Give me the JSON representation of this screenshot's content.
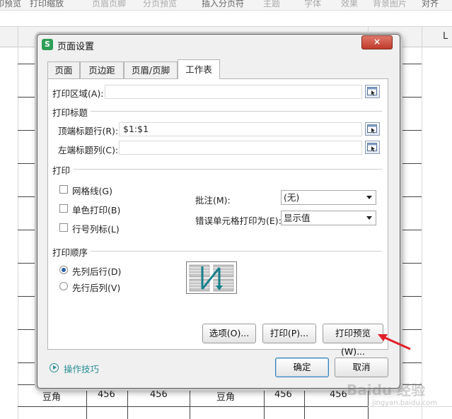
{
  "toolbar": {
    "items": [
      "印预览",
      "打印缩放",
      "页眉页脚",
      "分页预览",
      "插入分页符",
      "主题",
      "字体",
      "效果",
      "背景图片",
      "对齐"
    ]
  },
  "sheet": {
    "column_label_L": "L",
    "data_row": [
      "豆角",
      "456",
      "456",
      "豆角",
      "456",
      "456"
    ]
  },
  "dialog": {
    "title": "页面设置",
    "app_icon_letter": "S",
    "close_label": "×",
    "tabs": [
      "页面",
      "页边距",
      "页眉/页脚",
      "工作表"
    ],
    "active_tab": "工作表",
    "print_area_label": "打印区域(A):",
    "print_area_value": "",
    "print_titles_section": "打印标题",
    "top_rows_label": "顶端标题行(R):",
    "top_rows_value": "$1:$1",
    "left_cols_label": "左端标题列(C):",
    "left_cols_value": "",
    "print_section": "打印",
    "gridlines_label": "网格线(G)",
    "mono_label": "单色打印(B)",
    "rowcol_label": "行号列标(L)",
    "comments_label": "批注(M):",
    "comments_value": "(无)",
    "errors_label": "错误单元格打印为(E):",
    "errors_value": "显示值",
    "order_section": "打印顺序",
    "order_down_then_over": "先列后行(D)",
    "order_over_then_down": "先行后列(V)",
    "options_button": "选项(O)...",
    "print_button": "打印(P)...",
    "preview_button": "打印预览(W)...",
    "tips_label": "操作技巧",
    "ok_button": "确定",
    "cancel_button": "取消"
  },
  "watermark": {
    "text": "Baidu 经验",
    "sub": "jingyan.baidu.com"
  },
  "colors": {
    "accent_teal": "#2a8f99",
    "close_red": "#c03a2b",
    "arrow_red": "#e0202a",
    "app_green": "#2e9e56"
  }
}
